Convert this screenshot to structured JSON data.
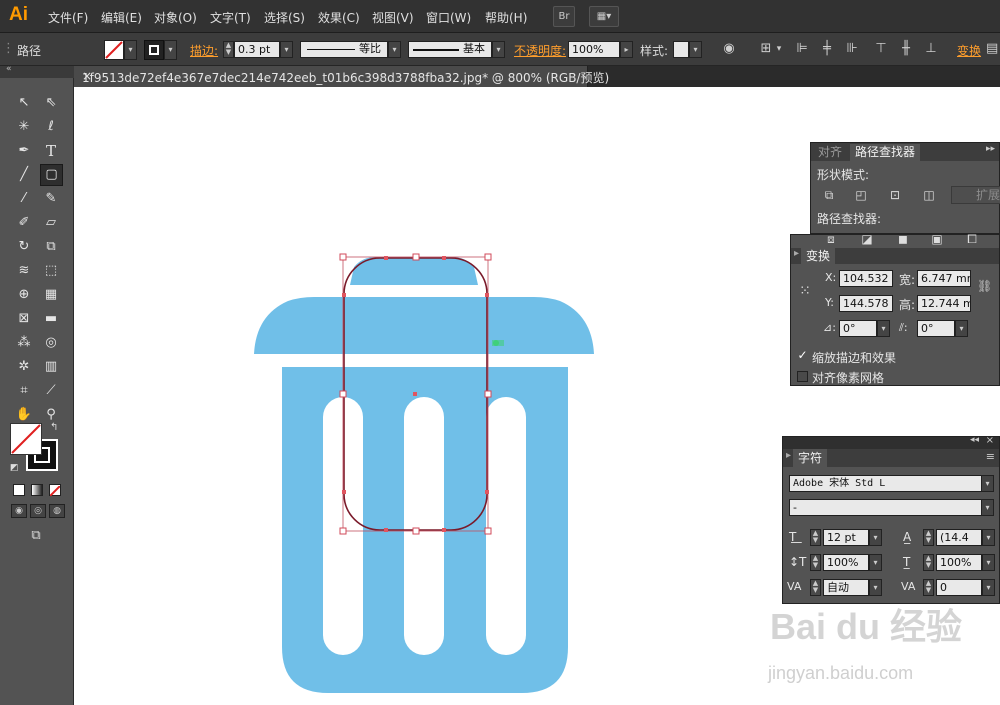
{
  "app": {
    "logo": "Ai"
  },
  "menu": [
    "文件(F)",
    "编辑(E)",
    "对象(O)",
    "文字(T)",
    "选择(S)",
    "效果(C)",
    "视图(V)",
    "窗口(W)",
    "帮助(H)"
  ],
  "menubar_buttons": {
    "bridge": "Br"
  },
  "options": {
    "object_type": "路径",
    "stroke_label": "描边:",
    "stroke_weight": "0.3 pt",
    "profile1": "等比",
    "profile2": "基本",
    "opacity_label": "不透明度:",
    "opacity_value": "100%",
    "style_label": "样式:",
    "transform_link": "变换"
  },
  "document": {
    "tab_title": "1f9513de72ef4e367e7dec214e742eeb_t01b6c398d3788fba32.jpg* @ 800% (RGB/预览)",
    "close": "×"
  },
  "colors": {
    "icon_blue": "#70bfe8",
    "anchor": "#e0505a",
    "path": "#7a1a2a",
    "accent": "#ff9a00"
  },
  "pathfinder_panel": {
    "tab_align": "对齐",
    "tab_pathfinder": "路径查找器",
    "shape_modes_label": "形状模式:",
    "expand_button": "扩展",
    "pathfinders_label": "路径查找器:"
  },
  "transform_panel": {
    "tab": "变换",
    "x_label": "X:",
    "x_value": "104.532",
    "y_label": "Y:",
    "y_value": "144.578",
    "w_label": "宽:",
    "w_value": "6.747 mm",
    "h_label": "高:",
    "h_value": "12.744 m",
    "rotate_value": "0°",
    "shear_value": "0°",
    "scale_strokes_label": "缩放描边和效果",
    "scale_strokes_checked": true,
    "align_pixel_label": "对齐像素网格",
    "align_pixel_checked": false
  },
  "character_panel": {
    "tab": "字符",
    "font_family": "Adobe 宋体 Std L",
    "font_style": "-",
    "font_size": "12 pt",
    "leading": "(14.4",
    "vertical_scale": "100%",
    "horizontal_scale": "100%",
    "kerning": "自动",
    "tracking": "0"
  },
  "watermark": {
    "text": "Bai du 经验",
    "sub": "jingyan.baidu.com"
  }
}
